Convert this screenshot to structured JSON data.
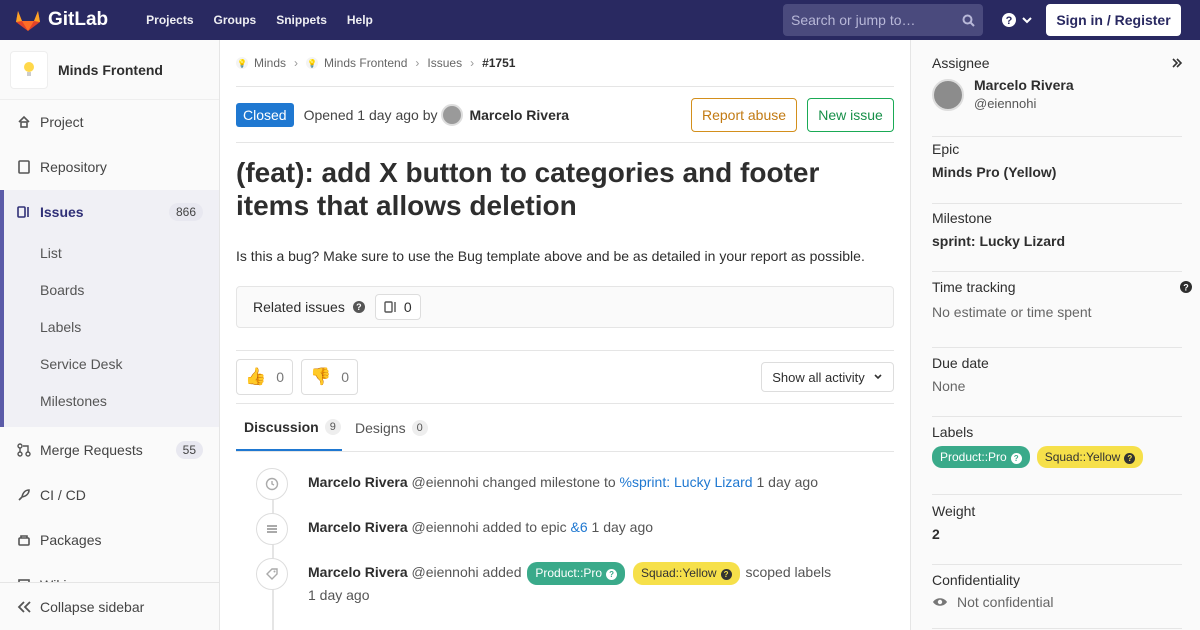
{
  "topbar": {
    "brand": "GitLab",
    "nav": [
      "Projects",
      "Groups",
      "Snippets",
      "Help"
    ],
    "search_placeholder": "Search or jump to…",
    "signin": "Sign in / Register"
  },
  "sidebar": {
    "project_name": "Minds Frontend",
    "items": [
      {
        "label": "Project",
        "icon": "home-icon"
      },
      {
        "label": "Repository",
        "icon": "book-icon"
      },
      {
        "label": "Issues",
        "icon": "issues-icon",
        "count": "866"
      },
      {
        "label": "Merge Requests",
        "icon": "merge-request-icon",
        "count": "55"
      },
      {
        "label": "CI / CD",
        "icon": "rocket-icon"
      },
      {
        "label": "Packages",
        "icon": "package-icon"
      },
      {
        "label": "Wiki",
        "icon": "wiki-icon"
      }
    ],
    "sub_items": [
      "List",
      "Boards",
      "Labels",
      "Service Desk",
      "Milestones"
    ],
    "collapse": "Collapse sidebar"
  },
  "breadcrumb": [
    "Minds",
    "Minds Frontend",
    "Issues",
    "#1751"
  ],
  "issue": {
    "status": "Closed",
    "opened": "Opened 1 day ago by",
    "author": "Marcelo Rivera",
    "report_abuse": "Report abuse",
    "new_issue": "New issue",
    "title": "(feat): add X button to categories and footer items that allows deletion",
    "description": "Is this a bug? Make sure to use the Bug template above and be as detailed in your report as possible.",
    "related_label": "Related issues",
    "related_count": "0",
    "thumbs_up": "0",
    "thumbs_down": "0",
    "activity_filter": "Show all activity"
  },
  "tabs": [
    {
      "label": "Discussion",
      "count": "9"
    },
    {
      "label": "Designs",
      "count": "0"
    }
  ],
  "notes": [
    {
      "author": "Marcelo Rivera",
      "handle": "@eiennohi",
      "action": "changed milestone to",
      "link": "%sprint: Lucky Lizard",
      "time": "1 day ago"
    },
    {
      "author": "Marcelo Rivera",
      "handle": "@eiennohi",
      "action": "added to epic",
      "link": "&6",
      "time": "1 day ago"
    },
    {
      "author": "Marcelo Rivera",
      "handle": "@eiennohi",
      "action": "added",
      "label1": "Product::Pro",
      "label2": "Squad::Yellow",
      "suffix": "scoped labels",
      "time": "1 day ago"
    }
  ],
  "right": {
    "assignee_title": "Assignee",
    "assignee_name": "Marcelo Rivera",
    "assignee_handle": "@eiennohi",
    "epic_title": "Epic",
    "epic": "Minds Pro (Yellow)",
    "milestone_title": "Milestone",
    "milestone": "sprint: Lucky Lizard",
    "time_title": "Time tracking",
    "time_value": "No estimate or time spent",
    "due_title": "Due date",
    "due_value": "None",
    "labels_title": "Labels",
    "label1": "Product::Pro",
    "label2": "Squad::Yellow",
    "weight_title": "Weight",
    "weight": "2",
    "conf_title": "Confidentiality",
    "conf_value": "Not confidential"
  },
  "colors": {
    "nav": "#292961",
    "closed": "#1f78d1",
    "label_pro": "#3aaa8a",
    "label_yellow": "#f6e04a"
  }
}
